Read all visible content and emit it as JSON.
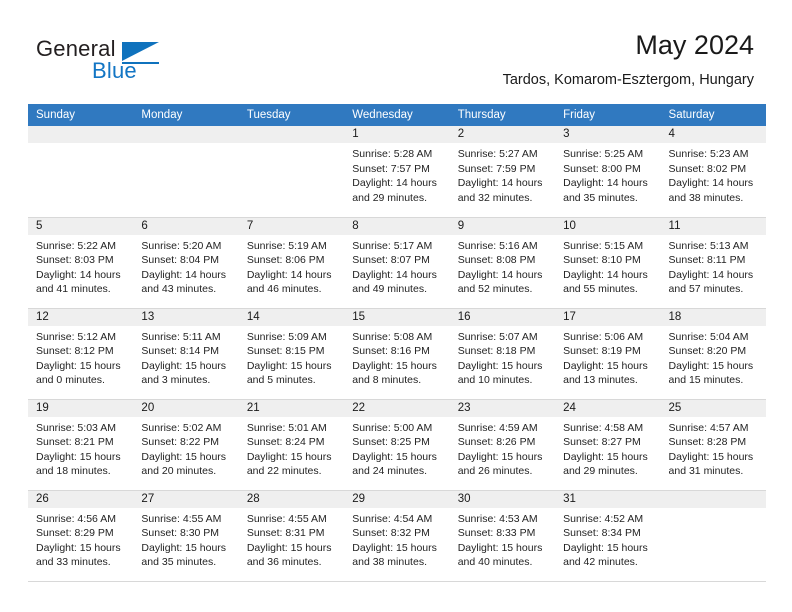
{
  "brand": {
    "name_part1": "General",
    "name_part2": "Blue",
    "flag_icon": "triangle-flag-icon"
  },
  "header": {
    "title": "May 2024",
    "subtitle": "Tardos, Komarom-Esztergom, Hungary"
  },
  "colors": {
    "header_row_bg": "#3079c0",
    "day_number_bg": "#efefef",
    "brand_blue": "#1275c4",
    "cell_divider": "#2f6fa8"
  },
  "weekday_headers": [
    "Sunday",
    "Monday",
    "Tuesday",
    "Wednesday",
    "Thursday",
    "Friday",
    "Saturday"
  ],
  "weeks": [
    [
      {
        "day": "",
        "empty": true,
        "sunrise": "",
        "sunset": "",
        "daylight_line1": "",
        "daylight_line2": ""
      },
      {
        "day": "",
        "empty": true,
        "sunrise": "",
        "sunset": "",
        "daylight_line1": "",
        "daylight_line2": ""
      },
      {
        "day": "",
        "empty": true,
        "sunrise": "",
        "sunset": "",
        "daylight_line1": "",
        "daylight_line2": ""
      },
      {
        "day": "1",
        "sunrise": "Sunrise: 5:28 AM",
        "sunset": "Sunset: 7:57 PM",
        "daylight_line1": "Daylight: 14 hours",
        "daylight_line2": "and 29 minutes."
      },
      {
        "day": "2",
        "sunrise": "Sunrise: 5:27 AM",
        "sunset": "Sunset: 7:59 PM",
        "daylight_line1": "Daylight: 14 hours",
        "daylight_line2": "and 32 minutes."
      },
      {
        "day": "3",
        "sunrise": "Sunrise: 5:25 AM",
        "sunset": "Sunset: 8:00 PM",
        "daylight_line1": "Daylight: 14 hours",
        "daylight_line2": "and 35 minutes."
      },
      {
        "day": "4",
        "sunrise": "Sunrise: 5:23 AM",
        "sunset": "Sunset: 8:02 PM",
        "daylight_line1": "Daylight: 14 hours",
        "daylight_line2": "and 38 minutes."
      }
    ],
    [
      {
        "day": "5",
        "sunrise": "Sunrise: 5:22 AM",
        "sunset": "Sunset: 8:03 PM",
        "daylight_line1": "Daylight: 14 hours",
        "daylight_line2": "and 41 minutes."
      },
      {
        "day": "6",
        "sunrise": "Sunrise: 5:20 AM",
        "sunset": "Sunset: 8:04 PM",
        "daylight_line1": "Daylight: 14 hours",
        "daylight_line2": "and 43 minutes."
      },
      {
        "day": "7",
        "sunrise": "Sunrise: 5:19 AM",
        "sunset": "Sunset: 8:06 PM",
        "daylight_line1": "Daylight: 14 hours",
        "daylight_line2": "and 46 minutes."
      },
      {
        "day": "8",
        "sunrise": "Sunrise: 5:17 AM",
        "sunset": "Sunset: 8:07 PM",
        "daylight_line1": "Daylight: 14 hours",
        "daylight_line2": "and 49 minutes."
      },
      {
        "day": "9",
        "sunrise": "Sunrise: 5:16 AM",
        "sunset": "Sunset: 8:08 PM",
        "daylight_line1": "Daylight: 14 hours",
        "daylight_line2": "and 52 minutes."
      },
      {
        "day": "10",
        "sunrise": "Sunrise: 5:15 AM",
        "sunset": "Sunset: 8:10 PM",
        "daylight_line1": "Daylight: 14 hours",
        "daylight_line2": "and 55 minutes."
      },
      {
        "day": "11",
        "sunrise": "Sunrise: 5:13 AM",
        "sunset": "Sunset: 8:11 PM",
        "daylight_line1": "Daylight: 14 hours",
        "daylight_line2": "and 57 minutes."
      }
    ],
    [
      {
        "day": "12",
        "sunrise": "Sunrise: 5:12 AM",
        "sunset": "Sunset: 8:12 PM",
        "daylight_line1": "Daylight: 15 hours",
        "daylight_line2": "and 0 minutes."
      },
      {
        "day": "13",
        "sunrise": "Sunrise: 5:11 AM",
        "sunset": "Sunset: 8:14 PM",
        "daylight_line1": "Daylight: 15 hours",
        "daylight_line2": "and 3 minutes."
      },
      {
        "day": "14",
        "sunrise": "Sunrise: 5:09 AM",
        "sunset": "Sunset: 8:15 PM",
        "daylight_line1": "Daylight: 15 hours",
        "daylight_line2": "and 5 minutes."
      },
      {
        "day": "15",
        "sunrise": "Sunrise: 5:08 AM",
        "sunset": "Sunset: 8:16 PM",
        "daylight_line1": "Daylight: 15 hours",
        "daylight_line2": "and 8 minutes."
      },
      {
        "day": "16",
        "sunrise": "Sunrise: 5:07 AM",
        "sunset": "Sunset: 8:18 PM",
        "daylight_line1": "Daylight: 15 hours",
        "daylight_line2": "and 10 minutes."
      },
      {
        "day": "17",
        "sunrise": "Sunrise: 5:06 AM",
        "sunset": "Sunset: 8:19 PM",
        "daylight_line1": "Daylight: 15 hours",
        "daylight_line2": "and 13 minutes."
      },
      {
        "day": "18",
        "sunrise": "Sunrise: 5:04 AM",
        "sunset": "Sunset: 8:20 PM",
        "daylight_line1": "Daylight: 15 hours",
        "daylight_line2": "and 15 minutes."
      }
    ],
    [
      {
        "day": "19",
        "sunrise": "Sunrise: 5:03 AM",
        "sunset": "Sunset: 8:21 PM",
        "daylight_line1": "Daylight: 15 hours",
        "daylight_line2": "and 18 minutes."
      },
      {
        "day": "20",
        "sunrise": "Sunrise: 5:02 AM",
        "sunset": "Sunset: 8:22 PM",
        "daylight_line1": "Daylight: 15 hours",
        "daylight_line2": "and 20 minutes."
      },
      {
        "day": "21",
        "sunrise": "Sunrise: 5:01 AM",
        "sunset": "Sunset: 8:24 PM",
        "daylight_line1": "Daylight: 15 hours",
        "daylight_line2": "and 22 minutes."
      },
      {
        "day": "22",
        "sunrise": "Sunrise: 5:00 AM",
        "sunset": "Sunset: 8:25 PM",
        "daylight_line1": "Daylight: 15 hours",
        "daylight_line2": "and 24 minutes."
      },
      {
        "day": "23",
        "sunrise": "Sunrise: 4:59 AM",
        "sunset": "Sunset: 8:26 PM",
        "daylight_line1": "Daylight: 15 hours",
        "daylight_line2": "and 26 minutes."
      },
      {
        "day": "24",
        "sunrise": "Sunrise: 4:58 AM",
        "sunset": "Sunset: 8:27 PM",
        "daylight_line1": "Daylight: 15 hours",
        "daylight_line2": "and 29 minutes."
      },
      {
        "day": "25",
        "sunrise": "Sunrise: 4:57 AM",
        "sunset": "Sunset: 8:28 PM",
        "daylight_line1": "Daylight: 15 hours",
        "daylight_line2": "and 31 minutes."
      }
    ],
    [
      {
        "day": "26",
        "sunrise": "Sunrise: 4:56 AM",
        "sunset": "Sunset: 8:29 PM",
        "daylight_line1": "Daylight: 15 hours",
        "daylight_line2": "and 33 minutes."
      },
      {
        "day": "27",
        "sunrise": "Sunrise: 4:55 AM",
        "sunset": "Sunset: 8:30 PM",
        "daylight_line1": "Daylight: 15 hours",
        "daylight_line2": "and 35 minutes."
      },
      {
        "day": "28",
        "sunrise": "Sunrise: 4:55 AM",
        "sunset": "Sunset: 8:31 PM",
        "daylight_line1": "Daylight: 15 hours",
        "daylight_line2": "and 36 minutes."
      },
      {
        "day": "29",
        "sunrise": "Sunrise: 4:54 AM",
        "sunset": "Sunset: 8:32 PM",
        "daylight_line1": "Daylight: 15 hours",
        "daylight_line2": "and 38 minutes."
      },
      {
        "day": "30",
        "sunrise": "Sunrise: 4:53 AM",
        "sunset": "Sunset: 8:33 PM",
        "daylight_line1": "Daylight: 15 hours",
        "daylight_line2": "and 40 minutes."
      },
      {
        "day": "31",
        "sunrise": "Sunrise: 4:52 AM",
        "sunset": "Sunset: 8:34 PM",
        "daylight_line1": "Daylight: 15 hours",
        "daylight_line2": "and 42 minutes."
      },
      {
        "day": "",
        "empty": true,
        "sunrise": "",
        "sunset": "",
        "daylight_line1": "",
        "daylight_line2": ""
      }
    ]
  ]
}
